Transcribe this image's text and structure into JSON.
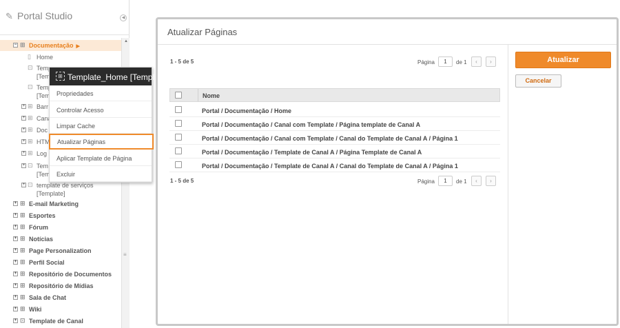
{
  "sidebar": {
    "title": "Portal Studio",
    "tree": [
      {
        "label": "Documentação",
        "level": 0,
        "expander": "minus",
        "icon": "site-icon",
        "selected": true,
        "arrow": true
      },
      {
        "label": "Home",
        "level": 1,
        "expander": "none",
        "icon": "page-icon"
      },
      {
        "label": "Temp",
        "level": 1,
        "expander": "none",
        "icon": "template-icon",
        "label2": "[Tem"
      },
      {
        "label": "Temp",
        "level": 1,
        "expander": "none",
        "icon": "template-icon",
        "label2": "[Tem"
      },
      {
        "label": "Barr",
        "level": 1,
        "expander": "plus",
        "icon": "channel-icon"
      },
      {
        "label": "Cana",
        "level": 1,
        "expander": "plus",
        "icon": "channel-icon"
      },
      {
        "label": "Doc",
        "level": 1,
        "expander": "plus",
        "icon": "channel-icon"
      },
      {
        "label": "HTM",
        "level": 1,
        "expander": "plus",
        "icon": "channel-icon"
      },
      {
        "label": "Log",
        "level": 1,
        "expander": "plus",
        "icon": "channel-icon"
      },
      {
        "label": "Tem",
        "level": 1,
        "expander": "plus",
        "icon": "template-icon",
        "label2": "[Tem"
      },
      {
        "label": "template de serviços",
        "level": 1,
        "expander": "plus",
        "icon": "template-icon",
        "label2": "[Template]"
      },
      {
        "label": "E-mail Marketing",
        "level": 0,
        "expander": "plus",
        "icon": "site-icon"
      },
      {
        "label": "Esportes",
        "level": 0,
        "expander": "plus",
        "icon": "site-icon"
      },
      {
        "label": "Fórum",
        "level": 0,
        "expander": "plus",
        "icon": "site-icon"
      },
      {
        "label": "Notícias",
        "level": 0,
        "expander": "plus",
        "icon": "site-icon"
      },
      {
        "label": "Page Personalization",
        "level": 0,
        "expander": "plus",
        "icon": "site-icon"
      },
      {
        "label": "Perfil Social",
        "level": 0,
        "expander": "plus",
        "icon": "site-icon"
      },
      {
        "label": "Repositório de Documentos",
        "level": 0,
        "expander": "plus",
        "icon": "site-icon"
      },
      {
        "label": "Repositório de Mídias",
        "level": 0,
        "expander": "plus",
        "icon": "site-icon"
      },
      {
        "label": "Sala de Chat",
        "level": 0,
        "expander": "plus",
        "icon": "site-icon"
      },
      {
        "label": "Wiki",
        "level": 0,
        "expander": "plus",
        "icon": "site-icon"
      },
      {
        "label": "Template de Canal",
        "level": 0,
        "expander": "plus",
        "icon": "template-icon"
      }
    ]
  },
  "context_menu": {
    "header": "Template_Home [Templ...",
    "items": [
      {
        "label": "Propriedades"
      },
      {
        "label": "Controlar Acesso"
      },
      {
        "label": "Limpar Cache"
      },
      {
        "label": "Atualizar Páginas",
        "highlighted": true
      },
      {
        "label": "Aplicar Template de Página"
      },
      {
        "label": "Excluir"
      }
    ]
  },
  "dialog": {
    "title": "Atualizar Páginas",
    "count_top": "1 - 5 de 5",
    "count_bottom": "1 - 5 de 5",
    "pager": {
      "label": "Página",
      "page": "1",
      "of": "de 1",
      "prev": "‹",
      "next": "›"
    },
    "table": {
      "header": "Nome",
      "rows": [
        "Portal / Documentação / Home",
        "Portal / Documentação / Canal com Template / Página template de Canal A",
        "Portal / Documentação / Canal com Template / Canal do Template de Canal A / Página 1",
        "Portal / Documentação / Template de Canal A / Página Template de Canal A",
        "Portal / Documentação / Template de Canal A / Canal do Template de Canal A / Página 1"
      ]
    },
    "buttons": {
      "update": "Atualizar",
      "cancel": "Cancelar"
    }
  },
  "colors": {
    "accent": "#ef8a2a",
    "menu_header": "#2b2b2b"
  }
}
